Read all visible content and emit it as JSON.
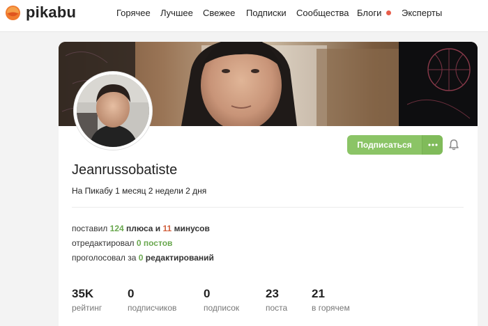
{
  "brand": {
    "name": "pikabu"
  },
  "nav": {
    "items": [
      {
        "label": "Горячее"
      },
      {
        "label": "Лучшее"
      },
      {
        "label": "Свежее"
      },
      {
        "label": "Подписки"
      },
      {
        "label": "Сообщества"
      },
      {
        "label": "Блоги",
        "has_dot": true
      },
      {
        "label": "Эксперты"
      }
    ]
  },
  "profile": {
    "username": "Jeanrussobatiste",
    "member_since": "На Пикабу 1 месяц 2 недели 2 дня",
    "subscribe_label": "Подписаться",
    "more_icon": "ellipsis-icon",
    "bell_icon": "bell-icon"
  },
  "activity": {
    "voted_prefix": "поставил",
    "pluses": "124",
    "pluses_label": "плюса и",
    "minuses": "11",
    "minuses_label": "минусов",
    "edited_prefix": "отредактировал",
    "posts_edited": "0",
    "posts_edited_label": "постов",
    "voted_edits_prefix": "проголосовал за",
    "edits_voted": "0",
    "edits_voted_label": "редактирований"
  },
  "metrics": [
    {
      "value": "35K",
      "label": "рейтинг"
    },
    {
      "value": "0",
      "label": "подписчиков"
    },
    {
      "value": "0",
      "label": "подписок"
    },
    {
      "value": "23",
      "label": "поста"
    },
    {
      "value": "21",
      "label": "в горячем"
    }
  ],
  "colors": {
    "accent_green": "#8bc466",
    "logo_orange": "#f07b2f",
    "minus_red": "#d1603d",
    "notification_dot": "#e85d4a"
  }
}
